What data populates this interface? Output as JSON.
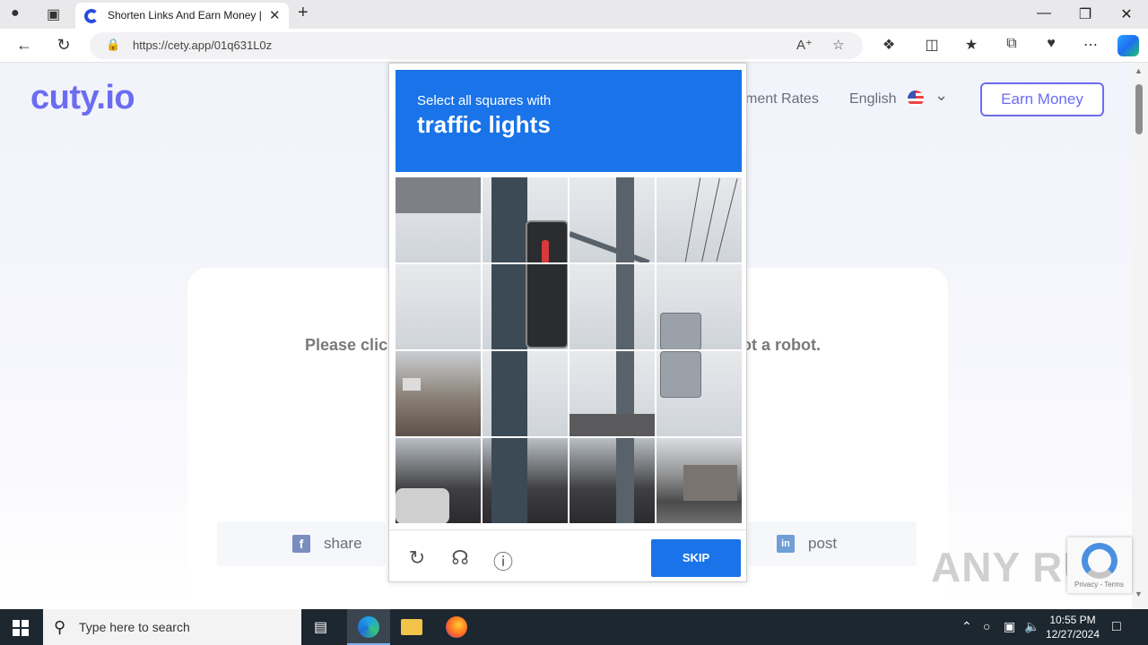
{
  "browser": {
    "tab_title": "Shorten Links And Earn Money | ",
    "url": "https://cety.app/01q631L0z"
  },
  "site": {
    "logo": "cuty.io",
    "nav_payment": "ment Rates",
    "language": "English",
    "earn_button": "Earn Money",
    "robot_left": "Please clic",
    "robot_right": "ot a robot.",
    "share_facebook": "share",
    "share_linkedin": "post"
  },
  "captcha": {
    "instruction": "Select all squares with",
    "target": "traffic lights",
    "skip_label": "SKIP"
  },
  "recaptcha_badge": {
    "text": "Privacy - Terms"
  },
  "watermark": "ANY RUN",
  "taskbar": {
    "search_placeholder": "Type here to search",
    "time": "10:55 PM",
    "date": "12/27/2024"
  },
  "colors": {
    "brand": "#6b6cf0",
    "captcha_blue": "#1a73e8",
    "taskbar": "#1c2730"
  }
}
